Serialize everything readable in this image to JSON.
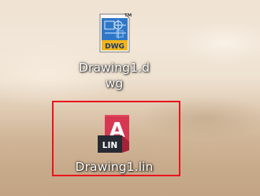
{
  "desktop": {
    "files": [
      {
        "id": "dwg",
        "icon": "autocad-dwg-file-icon",
        "icon_text": "DWG",
        "trademark": "TM",
        "label": "Drawing1.dwg",
        "selected": false
      },
      {
        "id": "lin",
        "icon": "autocad-lin-file-icon",
        "icon_letter": "A",
        "icon_text": "LIN",
        "label": "Drawing1.lin",
        "selected": true
      }
    ],
    "highlight_color": "#e8141c"
  }
}
